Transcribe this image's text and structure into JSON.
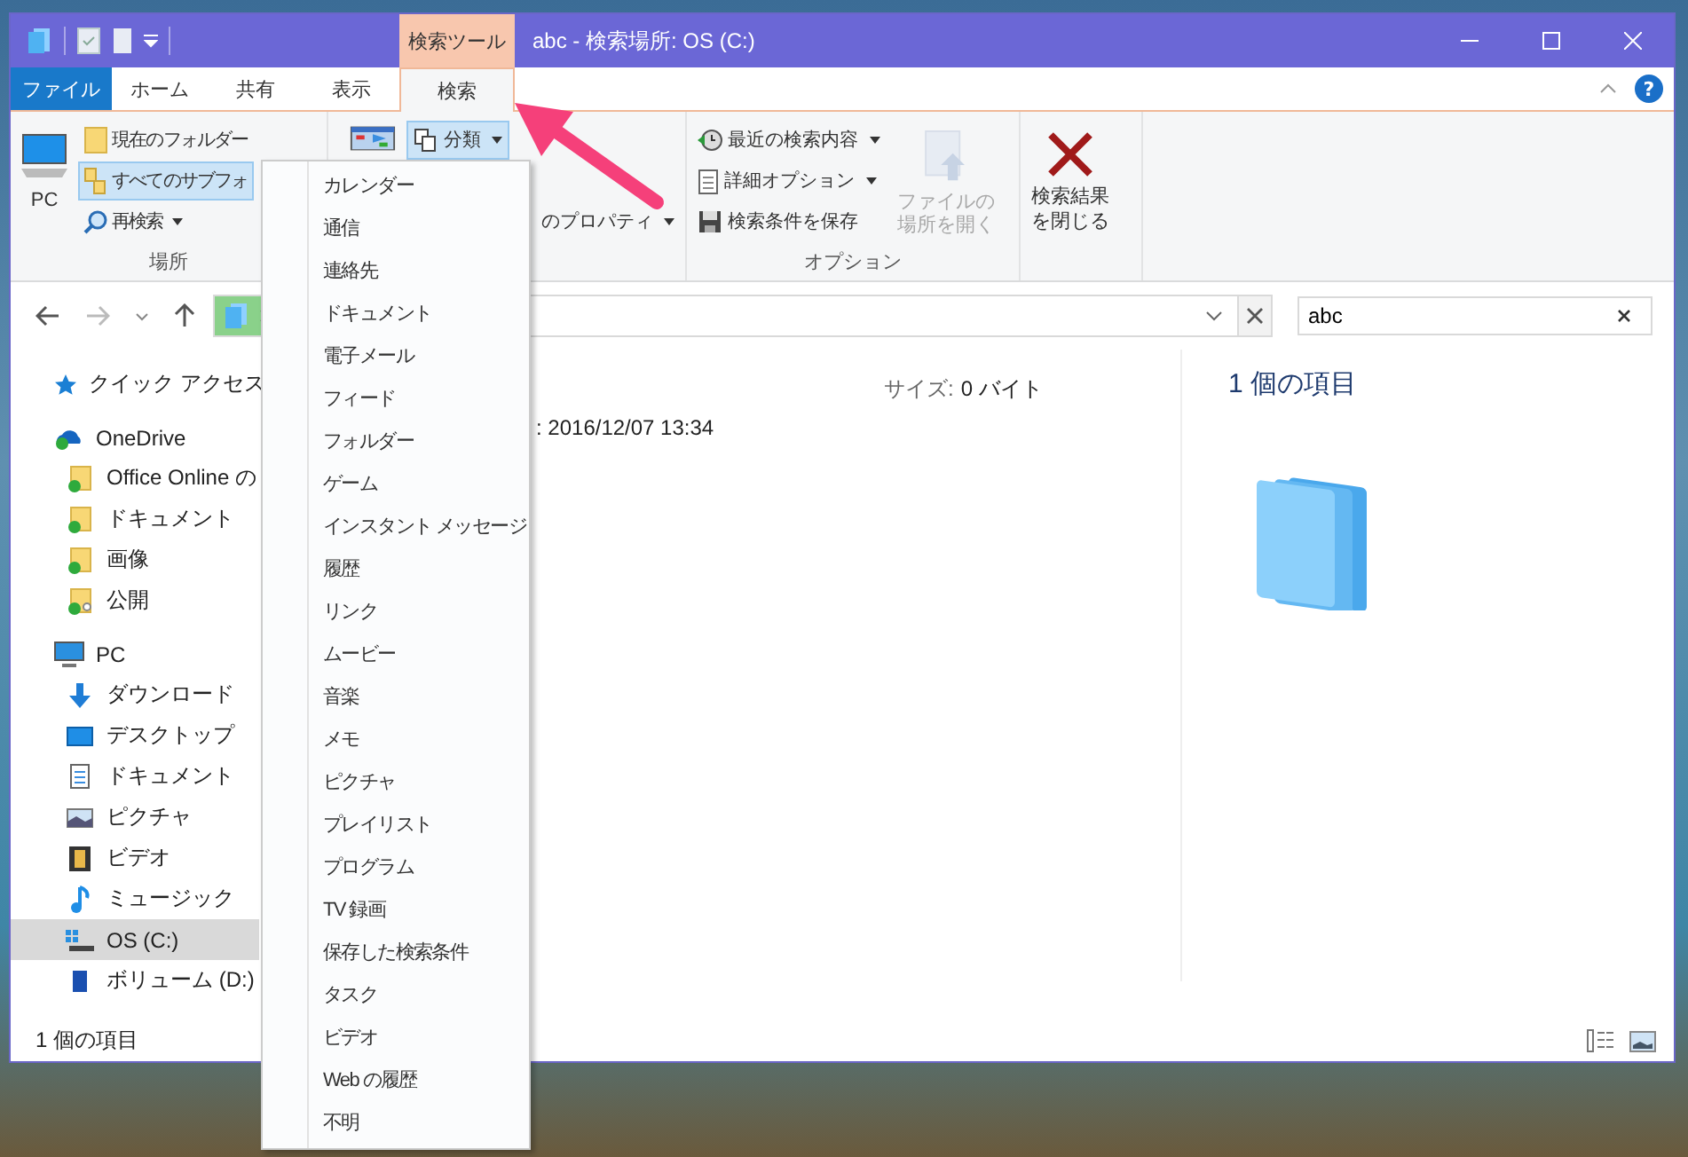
{
  "window": {
    "title": "abc - 検索場所: OS (C:)",
    "context_tab": "検索ツール"
  },
  "ribbon_tabs": [
    {
      "label": "ファイル",
      "kind": "file",
      "selected": false
    },
    {
      "label": "ホーム",
      "kind": "tab",
      "selected": false
    },
    {
      "label": "共有",
      "kind": "tab",
      "selected": false
    },
    {
      "label": "表示",
      "kind": "tab",
      "selected": false
    },
    {
      "label": "検索",
      "kind": "tab",
      "selected": true
    }
  ],
  "ribbon_help": "?",
  "ribbon_groups": [
    {
      "label": "場所",
      "buttons": [
        {
          "label": [
            "PC"
          ],
          "kind": "large",
          "selected": false,
          "disabled": false,
          "caret": false
        },
        {
          "label": "現在のフォルダー",
          "kind": "small",
          "selected": false,
          "disabled": false,
          "caret": false
        },
        {
          "label": "すべてのサブフォ",
          "kind": "small",
          "selected": true,
          "disabled": false,
          "caret": false
        },
        {
          "label": "再検索",
          "kind": "small",
          "selected": false,
          "disabled": false,
          "caret": true
        }
      ]
    },
    {
      "buttons": [
        {
          "kind": "large",
          "selected": false,
          "disabled": false,
          "caret": false
        },
        {
          "label": "分類",
          "kind": "small",
          "selected": true,
          "disabled": false,
          "caret": true
        },
        {
          "label": "のプロパティ",
          "kind": "small",
          "selected": false,
          "disabled": false,
          "caret": true
        }
      ]
    },
    {
      "label": "オプション",
      "buttons": [
        {
          "label": "最近の検索内容",
          "kind": "small",
          "selected": false,
          "disabled": false,
          "caret": true
        },
        {
          "label": "詳細オプション",
          "kind": "small",
          "selected": false,
          "disabled": false,
          "caret": true
        },
        {
          "label": "検索条件を保存",
          "kind": "small",
          "selected": false,
          "disabled": false,
          "caret": false
        },
        {
          "label": [
            "ファイルの",
            "場所を開く"
          ],
          "kind": "large",
          "selected": false,
          "disabled": true,
          "caret": false
        }
      ]
    },
    {
      "buttons": [
        {
          "label": [
            "検索結果",
            "を閉じる"
          ],
          "kind": "large",
          "selected": false,
          "disabled": false,
          "caret": false
        }
      ]
    }
  ],
  "search": {
    "value": "abc"
  },
  "navigation": {
    "items": [
      {
        "label": "クイック アクセス",
        "selected": false
      },
      {
        "label": "OneDrive",
        "selected": false,
        "children": [
          {
            "label": "Office Online の",
            "selected": false
          },
          {
            "label": "ドキュメント",
            "selected": false
          },
          {
            "label": "画像",
            "selected": false
          },
          {
            "label": "公開",
            "selected": false
          }
        ]
      },
      {
        "label": "PC",
        "selected": false,
        "children": [
          {
            "label": "ダウンロード",
            "selected": false
          },
          {
            "label": "デスクトップ",
            "selected": false
          },
          {
            "label": "ドキュメント",
            "selected": false
          },
          {
            "label": "ピクチャ",
            "selected": false
          },
          {
            "label": "ビデオ",
            "selected": false
          },
          {
            "label": "ミュージック",
            "selected": false
          },
          {
            "label": "OS (C:)",
            "selected": true
          },
          {
            "label": "ボリューム (D:)",
            "selected": false
          }
        ]
      }
    ]
  },
  "details": [
    {
      "label": "サイズ:",
      "value": "0 バイト"
    },
    {
      "value": ": 2016/12/07 13:34"
    }
  ],
  "preview": {
    "heading": "1 個の項目"
  },
  "status_bar": {
    "text": "1 個の項目"
  },
  "type_menu": {
    "items": [
      "カレンダー",
      "通信",
      "連絡先",
      "ドキュメント",
      "電子メール",
      "フィード",
      "フォルダー",
      "ゲーム",
      "インスタント メッセージ",
      "履歴",
      "リンク",
      "ムービー",
      "音楽",
      "メモ",
      "ピクチャ",
      "プレイリスト",
      "プログラム",
      "TV 録画",
      "保存した検索条件",
      "タスク",
      "ビデオ",
      "Web の履歴",
      "不明"
    ]
  }
}
